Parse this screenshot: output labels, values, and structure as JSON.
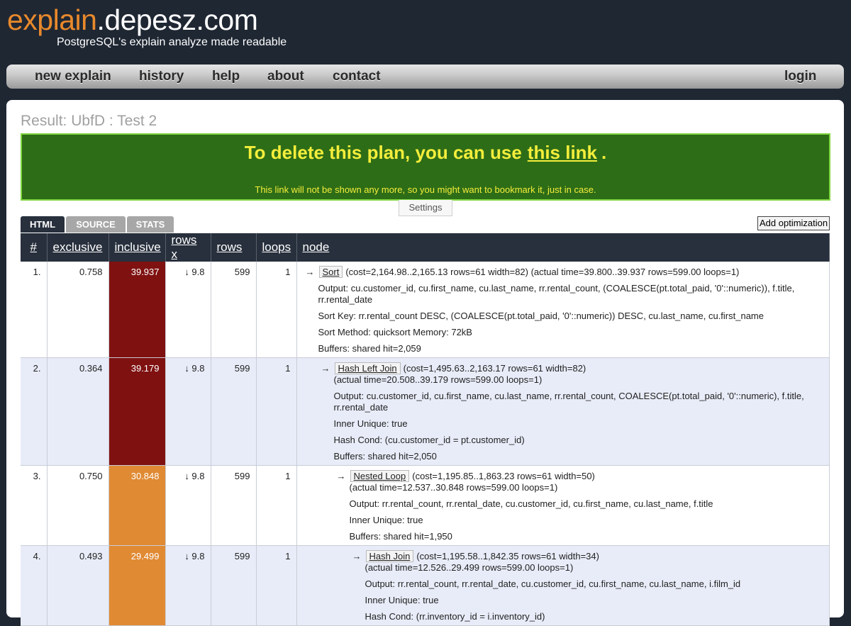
{
  "site": {
    "logo_part1": "explain",
    "logo_part2": ".depesz.com",
    "tagline": "PostgreSQL's explain analyze made readable"
  },
  "nav": {
    "new_explain": "new explain",
    "history": "history",
    "help": "help",
    "about": "about",
    "contact": "contact",
    "login": "login"
  },
  "result": {
    "title": "Result: UbfD : Test 2"
  },
  "notice": {
    "text_before": "To delete this plan, you can use",
    "link": "this link",
    "text_after": ".",
    "small": "This link will not be shown any more, so you might want to bookmark it, just in case."
  },
  "settings_label": "Settings",
  "tabs": {
    "html": "HTML",
    "source": "SOURCE",
    "stats": "STATS"
  },
  "add_optimization": "Add optimization",
  "columns": {
    "num": "#",
    "exclusive": "exclusive",
    "inclusive": "inclusive",
    "rows_x": "rows x",
    "rows": "rows",
    "loops": "loops",
    "node": "node"
  },
  "colors": {
    "inclusive_high": "#7f1111",
    "inclusive_mid": "#e08a33",
    "row_even": "#e8ecf8",
    "header_bg": "#28303d",
    "notice_bg": "#2e6d17",
    "notice_text": "#f4ee3b"
  },
  "rows": [
    {
      "num": "1.",
      "exclusive": "0.758",
      "inclusive": "39.937",
      "rows_x": "↓ 9.8",
      "rows": "599",
      "loops": "1",
      "arrow": "→",
      "op": "Sort",
      "detail": "(cost=2,164.98..2,165.13 rows=61 width=82) (actual time=39.800..39.937 rows=599.00 loops=1)",
      "detail2": "",
      "extras": [
        "Output: cu.customer_id, cu.first_name, cu.last_name, rr.rental_count, (COALESCE(pt.total_paid, '0'::numeric)), f.title, rr.rental_date",
        "Sort Key: rr.rental_count DESC, (COALESCE(pt.total_paid, '0'::numeric)) DESC, cu.last_name, cu.first_name",
        "Sort Method: quicksort Memory: 72kB",
        "Buffers: shared hit=2,059"
      ]
    },
    {
      "num": "2.",
      "exclusive": "0.364",
      "inclusive": "39.179",
      "rows_x": "↓ 9.8",
      "rows": "599",
      "loops": "1",
      "arrow": "→",
      "op": "Hash Left Join",
      "detail": "(cost=1,495.63..2,163.17 rows=61 width=82)",
      "detail2": "(actual time=20.508..39.179 rows=599.00 loops=1)",
      "extras": [
        "Output: cu.customer_id, cu.first_name, cu.last_name, rr.rental_count, COALESCE(pt.total_paid, '0'::numeric), f.title, rr.rental_date",
        "Inner Unique: true",
        "Hash Cond: (cu.customer_id = pt.customer_id)",
        "Buffers: shared hit=2,050"
      ]
    },
    {
      "num": "3.",
      "exclusive": "0.750",
      "inclusive": "30.848",
      "rows_x": "↓ 9.8",
      "rows": "599",
      "loops": "1",
      "arrow": "→",
      "op": "Nested Loop",
      "detail": "(cost=1,195.85..1,863.23 rows=61 width=50)",
      "detail2": "(actual time=12.537..30.848 rows=599.00 loops=1)",
      "extras": [
        "Output: rr.rental_count, rr.rental_date, cu.customer_id, cu.first_name, cu.last_name, f.title",
        "Inner Unique: true",
        "Buffers: shared hit=1,950"
      ]
    },
    {
      "num": "4.",
      "exclusive": "0.493",
      "inclusive": "29.499",
      "rows_x": "↓ 9.8",
      "rows": "599",
      "loops": "1",
      "arrow": "→",
      "op": "Hash Join",
      "detail": "(cost=1,195.58..1,842.35 rows=61 width=34)",
      "detail2": "(actual time=12.526..29.499 rows=599.00 loops=1)",
      "extras": [
        "Output: rr.rental_count, rr.rental_date, cu.customer_id, cu.first_name, cu.last_name, i.film_id",
        "Inner Unique: true",
        "Hash Cond: (rr.inventory_id = i.inventory_id)"
      ]
    }
  ]
}
